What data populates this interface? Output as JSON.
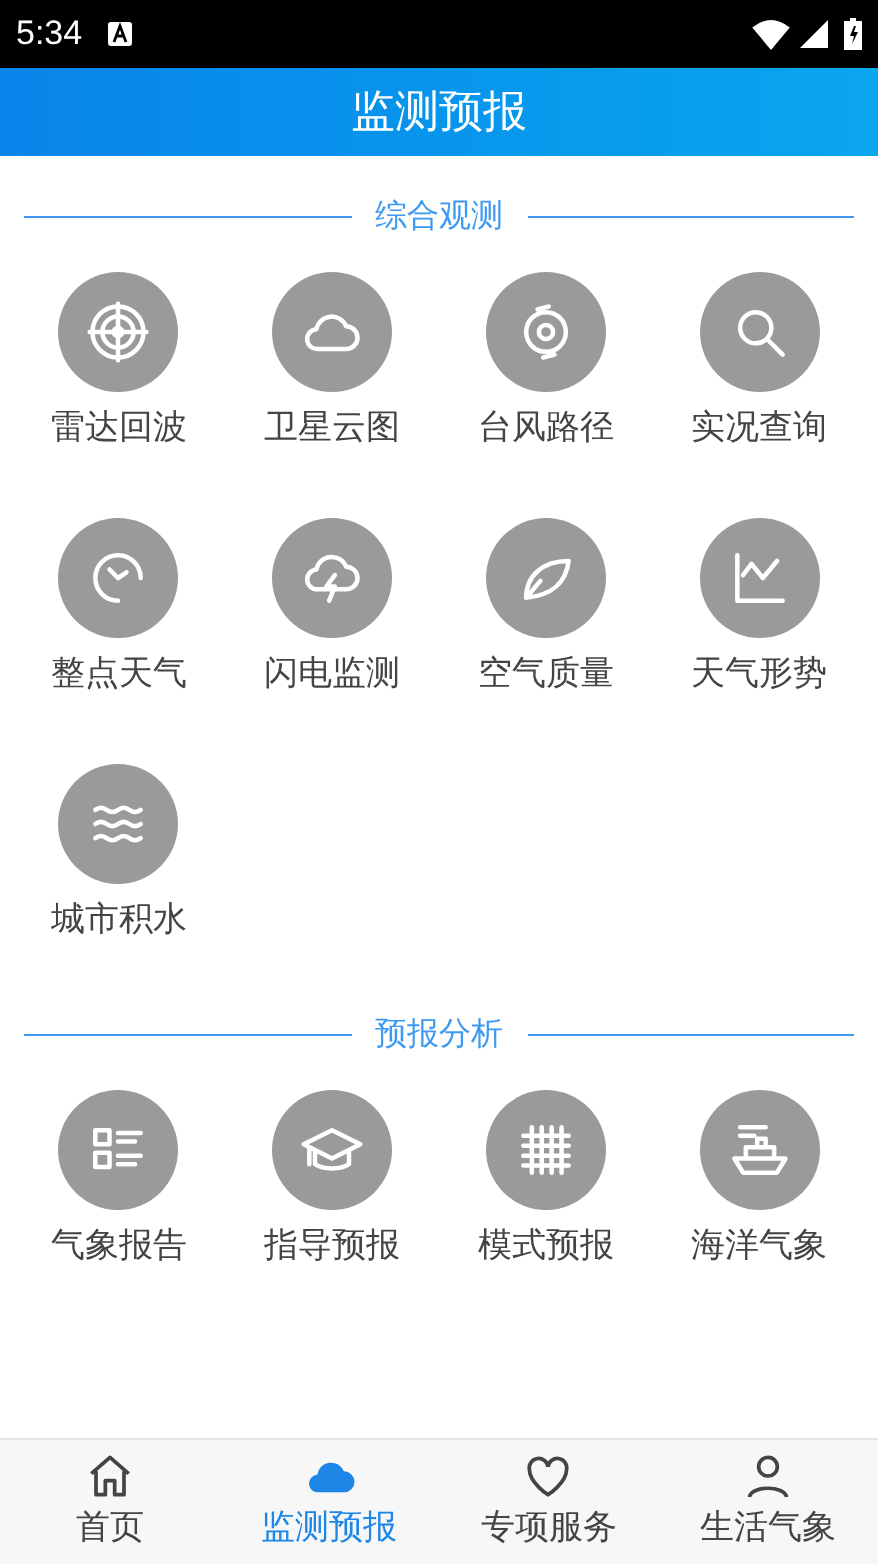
{
  "status_bar": {
    "time": "5:34"
  },
  "header": {
    "title": "监测预报"
  },
  "sections": [
    {
      "title": "综合观测",
      "items": [
        {
          "label": "雷达回波"
        },
        {
          "label": "卫星云图"
        },
        {
          "label": "台风路径"
        },
        {
          "label": "实况查询"
        },
        {
          "label": "整点天气"
        },
        {
          "label": "闪电监测"
        },
        {
          "label": "空气质量"
        },
        {
          "label": "天气形势"
        },
        {
          "label": "城市积水"
        }
      ]
    },
    {
      "title": "预报分析",
      "items": [
        {
          "label": "气象报告"
        },
        {
          "label": "指导预报"
        },
        {
          "label": "模式预报"
        },
        {
          "label": "海洋气象"
        }
      ]
    }
  ],
  "bottom_nav": [
    {
      "label": "首页",
      "selected": false
    },
    {
      "label": "监测预报",
      "selected": true
    },
    {
      "label": "专项服务",
      "selected": false
    },
    {
      "label": "生活气象",
      "selected": false
    }
  ]
}
